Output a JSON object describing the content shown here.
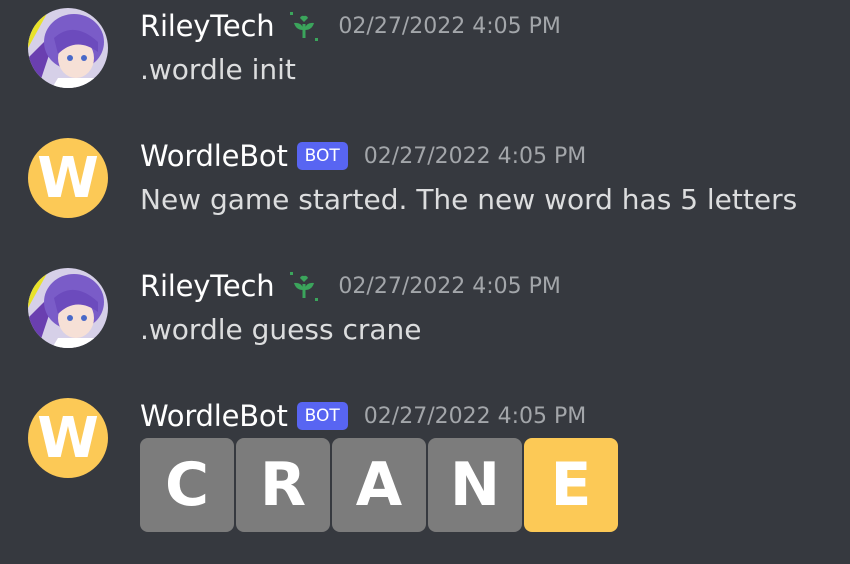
{
  "messages": [
    {
      "author": "RileyTech",
      "timestamp": "02/27/2022 4:05 PM",
      "content": ".wordle init"
    },
    {
      "author": "WordleBot",
      "bot_tag": "BOT",
      "avatar_letter": "W",
      "timestamp": "02/27/2022 4:05 PM",
      "content": "New game started. The new word has 5 letters"
    },
    {
      "author": "RileyTech",
      "timestamp": "02/27/2022 4:05 PM",
      "content": ".wordle guess crane"
    },
    {
      "author": "WordleBot",
      "bot_tag": "BOT",
      "avatar_letter": "W",
      "timestamp": "02/27/2022 4:05 PM",
      "tiles": [
        {
          "letter": "C",
          "status": "absent"
        },
        {
          "letter": "R",
          "status": "absent"
        },
        {
          "letter": "A",
          "status": "absent"
        },
        {
          "letter": "N",
          "status": "absent"
        },
        {
          "letter": "E",
          "status": "present"
        }
      ]
    }
  ],
  "colors": {
    "background": "#36393f",
    "bot_tag": "#5865f2",
    "bot_avatar": "#fcc956",
    "tile_absent": "#7c7c7c",
    "tile_present": "#fcc956",
    "badge_green": "#3ba55c"
  },
  "icons": {
    "user_badge": "sprout-heart-icon"
  }
}
